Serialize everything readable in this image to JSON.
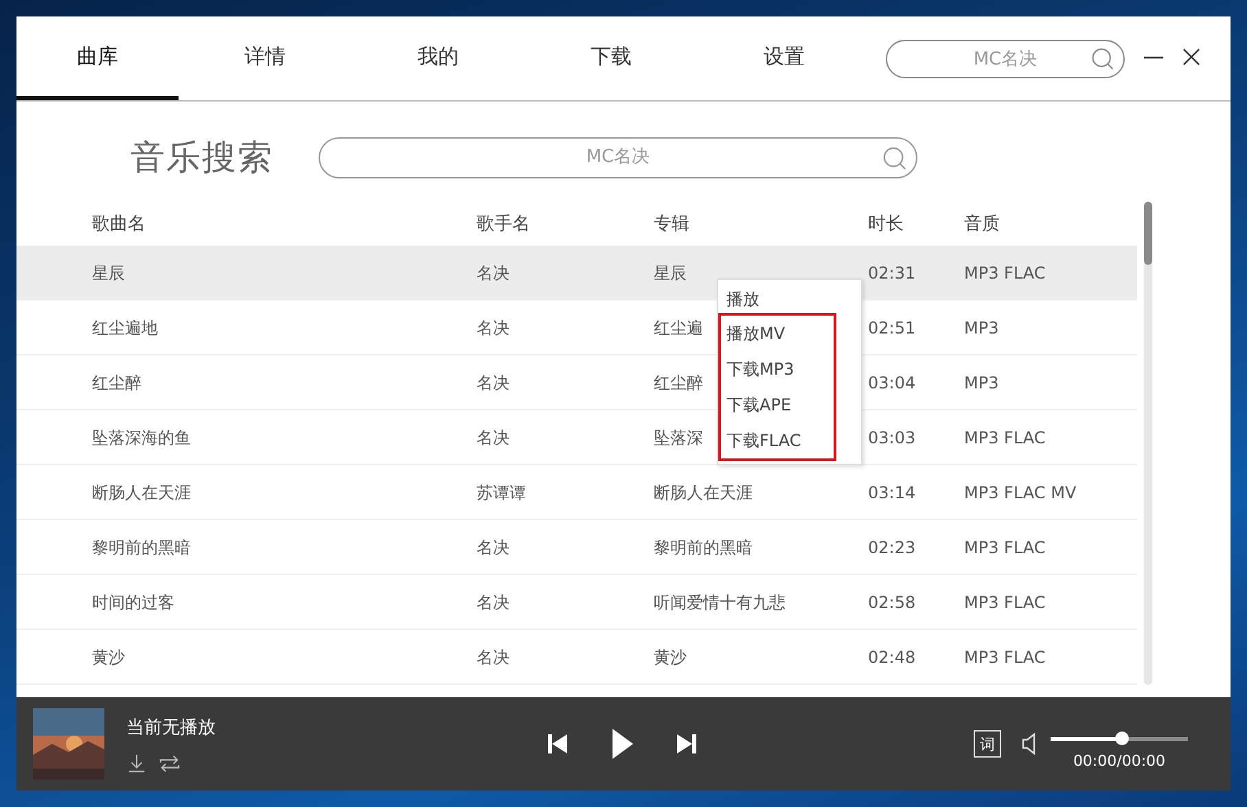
{
  "tabs": [
    {
      "label": "曲库",
      "selected": true
    },
    {
      "label": "详情",
      "selected": false
    },
    {
      "label": "我的",
      "selected": false
    },
    {
      "label": "下载",
      "selected": false
    },
    {
      "label": "设置",
      "selected": false
    }
  ],
  "header_search": {
    "placeholder": "MC名决"
  },
  "page_title": "音乐搜索",
  "search": {
    "placeholder": "MC名决"
  },
  "table": {
    "columns": [
      "歌曲名",
      "歌手名",
      "专辑",
      "时长",
      "音质"
    ],
    "rows": [
      {
        "cells": [
          "星辰",
          "名决",
          "星辰",
          "02:31",
          "MP3 FLAC"
        ],
        "selected": true
      },
      {
        "cells": [
          "红尘遍地",
          "名决",
          "红尘遍",
          "02:51",
          "MP3"
        ],
        "selected": false
      },
      {
        "cells": [
          "红尘醉",
          "名决",
          "红尘醉",
          "03:04",
          "MP3"
        ],
        "selected": false
      },
      {
        "cells": [
          "坠落深海的鱼",
          "名决",
          "坠落深",
          "03:03",
          "MP3 FLAC"
        ],
        "selected": false
      },
      {
        "cells": [
          "断肠人在天涯",
          "苏谭谭",
          "断肠人在天涯",
          "03:14",
          "MP3 FLAC MV"
        ],
        "selected": false
      },
      {
        "cells": [
          "黎明前的黑暗",
          "名决",
          "黎明前的黑暗",
          "02:23",
          "MP3 FLAC"
        ],
        "selected": false
      },
      {
        "cells": [
          "时间的过客",
          "名决",
          "听闻爱情十有九悲",
          "02:58",
          "MP3 FLAC"
        ],
        "selected": false
      },
      {
        "cells": [
          "黄沙",
          "名决",
          "黄沙",
          "02:48",
          "MP3 FLAC"
        ],
        "selected": false
      }
    ]
  },
  "context_menu": {
    "items": [
      {
        "label": "播放"
      }
    ],
    "framed_items": [
      {
        "label": "播放MV"
      },
      {
        "label": "下载MP3"
      },
      {
        "label": "下载APE"
      },
      {
        "label": "下载FLAC"
      }
    ]
  },
  "player": {
    "now_playing": "当前无播放",
    "lyrics_button": "词",
    "volume": {
      "level": 0.52
    },
    "time": "00:00/00:00"
  }
}
